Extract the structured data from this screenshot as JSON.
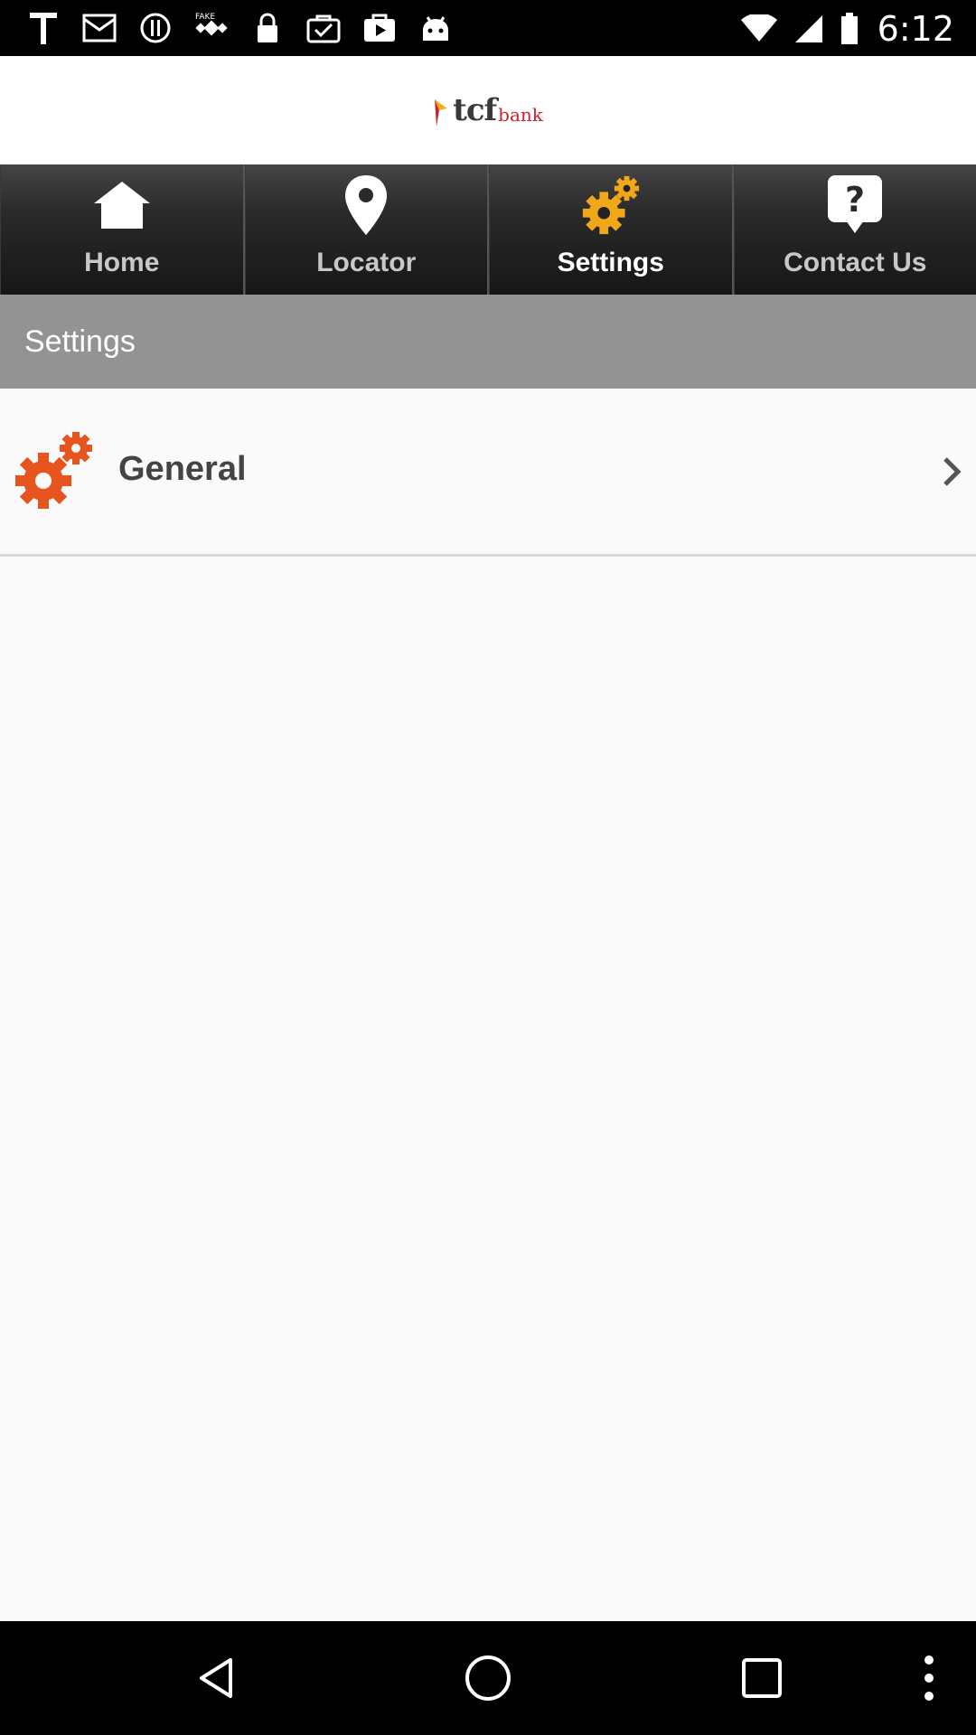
{
  "status_bar": {
    "time": "6:12",
    "icons": [
      "text-t-icon",
      "email-icon",
      "alert-icon",
      "fake-gps-icon",
      "lock-icon",
      "briefcase-check-icon",
      "play-store-icon",
      "android-icon"
    ]
  },
  "header": {
    "logo_text": "tcf",
    "logo_suffix": "bank"
  },
  "tabs": [
    {
      "label": "Home",
      "icon": "home-icon",
      "active": false
    },
    {
      "label": "Locator",
      "icon": "location-pin-icon",
      "active": false
    },
    {
      "label": "Settings",
      "icon": "gears-icon",
      "active": true
    },
    {
      "label": "Contact Us",
      "icon": "help-bubble-icon",
      "active": false
    }
  ],
  "section": {
    "title": "Settings"
  },
  "list": [
    {
      "label": "General",
      "icon": "gears-icon"
    }
  ],
  "nav_bar": {
    "buttons": [
      "back-icon",
      "home-circle-icon",
      "recents-icon",
      "more-icon"
    ]
  },
  "colors": {
    "accent_orange": "#e8541e",
    "settings_yellow": "#f0a818",
    "section_gray": "#939393"
  }
}
